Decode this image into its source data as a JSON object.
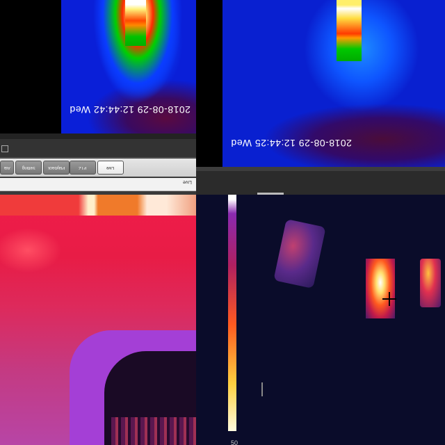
{
  "top_left_view": {
    "timestamp": "2018-08-29 12:44:42 Wed"
  },
  "top_right_view": {
    "timestamp": "2018-08-29 12:44:25 Wed"
  },
  "client_toolbar": {
    "tabs": [
      {
        "label": "Live",
        "active": true
      },
      {
        "label": "PTZ"
      },
      {
        "label": "Playback"
      },
      {
        "label": "Setting"
      },
      {
        "label": "Ala"
      }
    ],
    "address_text": "Live"
  },
  "bottom_right_view": {
    "scale_label": "50"
  },
  "colors": {
    "thermal_blue": "#0a1fd8",
    "hot_white": "#ffffff",
    "magenta_palette": "#e81c46"
  }
}
